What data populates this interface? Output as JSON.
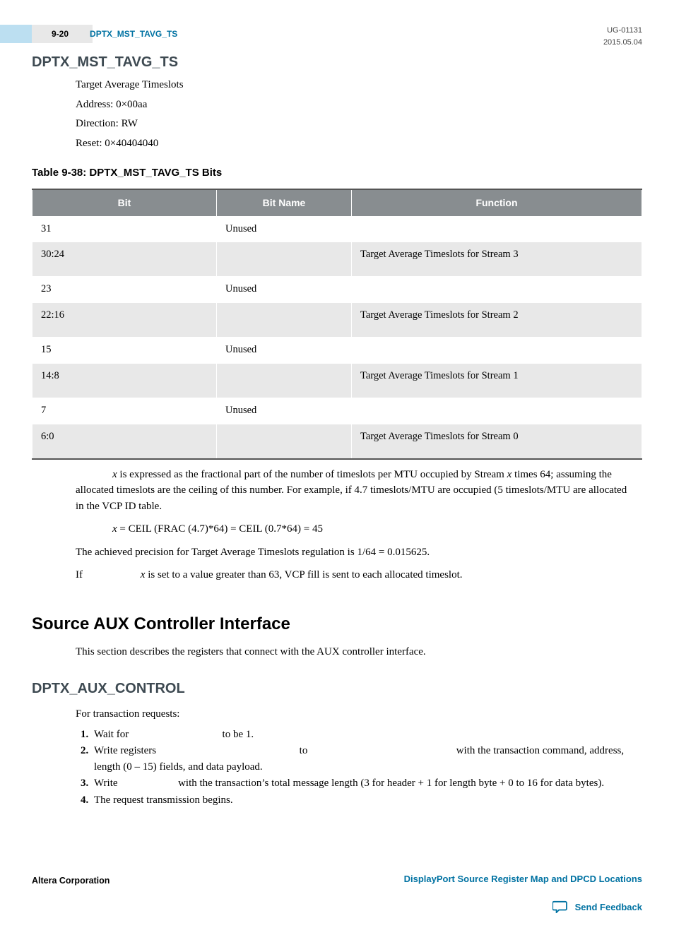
{
  "header": {
    "page_num": "9-20",
    "running_title": "DPTX_MST_TAVG_TS",
    "doc_id": "UG-01131",
    "date": "2015.05.04"
  },
  "section1": {
    "title": "DPTX_MST_TAVG_TS",
    "props": {
      "desc": "Target Average Timeslots",
      "address": "Address: 0×00aa",
      "direction": "Direction: RW",
      "reset": "Reset: 0×40404040"
    },
    "table_caption": "Table 9-38: DPTX_MST_TAVG_TS Bits",
    "table_headers": {
      "bit": "Bit",
      "bitname": "Bit Name",
      "function": "Function"
    },
    "table_rows": [
      {
        "bit": "31",
        "bitname": "Unused",
        "function": ""
      },
      {
        "bit": "30:24",
        "bitname": "",
        "function": "Target Average Timeslots for Stream 3"
      },
      {
        "bit": "23",
        "bitname": "Unused",
        "function": ""
      },
      {
        "bit": "22:16",
        "bitname": "",
        "function": "Target Average Timeslots for Stream 2"
      },
      {
        "bit": "15",
        "bitname": "Unused",
        "function": ""
      },
      {
        "bit": "14:8",
        "bitname": "",
        "function": "Target Average Timeslots for Stream 1"
      },
      {
        "bit": "7",
        "bitname": "Unused",
        "function": ""
      },
      {
        "bit": "6:0",
        "bitname": "",
        "function": "Target Average Timeslots for Stream 0"
      }
    ],
    "notes": {
      "p1_prefix_italic": "x",
      "p1_mid": " is expressed as the fractional part of the number of timeslots per MTU occupied by Stream ",
      "p1_suffix_italic": "x",
      "p1_tail": " times 64; assuming the allocated timeslots are the ceiling of this number. For example, if 4.7 timeslots/MTU are occupied (5 timeslots/MTU are allocated in the VCP ID table.",
      "p2_italic": "x",
      "p2_text": " = CEIL (FRAC (4.7)*64) = CEIL (0.7*64) = 45",
      "p3": "The achieved precision for Target Average Timeslots regulation is 1/64 = 0.015625.",
      "p4_pre": "If ",
      "p4_italic": "x",
      "p4_post": " is set to a value greater than 63, VCP fill is sent to each allocated timeslot."
    }
  },
  "section2": {
    "title": "Source AUX Controller Interface",
    "intro": "This section describes the registers that connect with the AUX controller interface."
  },
  "section3": {
    "title": "DPTX_AUX_CONTROL",
    "intro": "For transaction requests:",
    "steps": {
      "s1a": "Wait for ",
      "s1b": " to be 1.",
      "s2a": "Write registers ",
      "s2b": " to ",
      "s2c": " with the transaction command, address, length (0 – 15) fields, and data payload.",
      "s3a": "Write ",
      "s3b": " with the transaction’s total message length (3 for header + 1 for length byte + 0 to 16 for data bytes).",
      "s4": "The request transmission begins."
    }
  },
  "footer": {
    "left": "Altera Corporation",
    "right1": "DisplayPort Source Register Map and DPCD Locations",
    "feedback": "Send Feedback"
  }
}
